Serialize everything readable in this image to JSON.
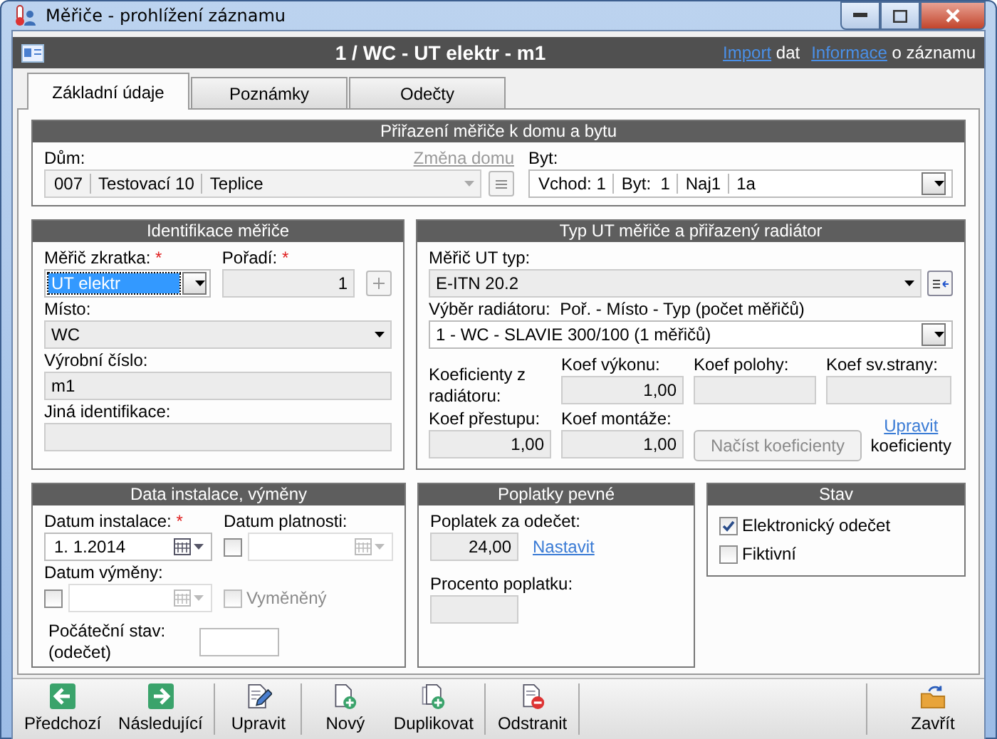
{
  "window": {
    "title": "Měřiče - prohlížení záznamu"
  },
  "header": {
    "title": "1 / WC - UT elektr - m1",
    "links": [
      {
        "link": "Import",
        "text": "dat"
      },
      {
        "link": "Informace",
        "text": "o záznamu"
      }
    ]
  },
  "tabs": [
    {
      "label": "Základní údaje",
      "selected": true
    },
    {
      "label": "Poznámky",
      "selected": false
    },
    {
      "label": "Odečty",
      "selected": false
    }
  ],
  "assignment": {
    "title": "Přiřazení měřiče k domu a bytu",
    "house_label": "Dům:",
    "change_link": "Změna domu",
    "house_cells": [
      "007",
      "Testovací 10",
      "Teplice"
    ],
    "flat_label": "Byt:",
    "flat_cells": [
      "Vchod: 1",
      "Byt:  1",
      "Naj1",
      "1a"
    ]
  },
  "identification": {
    "title": "Identifikace měřiče",
    "code": {
      "label": "Měřič zkratka:",
      "mark": "*",
      "value": "UT elektr"
    },
    "order": {
      "label": "Pořadí:",
      "mark": "*",
      "value": "1"
    },
    "place": {
      "label": "Místo:",
      "value": "WC"
    },
    "serial": {
      "label": "Výrobní číslo:",
      "value": "m1"
    },
    "other": {
      "label": "Jiná identifikace:"
    }
  },
  "meter_type": {
    "title": "Typ UT měřiče a přiřazený radiátor",
    "type": {
      "label": "Měřič UT typ:",
      "value": "E-ITN 20.2"
    },
    "radiator": {
      "label": "Výběr radiátoru:",
      "hint": "Poř. - Místo - Typ (počet měřičů)",
      "value": "1 - WC - SLAVIE 300/100 (1 měřičů)"
    },
    "coef_caption": "Koeficienty z radiátoru:",
    "coefs": [
      {
        "label": "Koef výkonu:",
        "value": "1,00"
      },
      {
        "label": "Koef polohy:"
      },
      {
        "label": "Koef sv.strany:"
      },
      {
        "label": "Koef přestupu:",
        "value": "1,00"
      },
      {
        "label": "Koef montáže:",
        "value": "1,00"
      }
    ],
    "load_button": "Načíst koeficienty",
    "edit_link": "Upravit",
    "edit_text": "koeficienty"
  },
  "installation": {
    "title": "Data instalace, výměny",
    "install": {
      "label": "Datum instalace:",
      "mark": "*",
      "value": "1.  1.2014"
    },
    "validity": {
      "label": "Datum platnosti:",
      "checked": false
    },
    "exchange": {
      "label": "Datum výměny:",
      "checked": false
    },
    "exchanged": {
      "label": "Vyměněný",
      "checked": false,
      "disabled": true
    },
    "initial": {
      "label": "Počáteční stav: (odečet)"
    }
  },
  "fees": {
    "title": "Poplatky pevné",
    "fee": {
      "label": "Poplatek za odečet:",
      "value": "24,00"
    },
    "set_link": "Nastavit",
    "percent": {
      "label": "Procento poplatku:"
    }
  },
  "status": {
    "title": "Stav",
    "options": [
      {
        "label": "Elektronický odečet",
        "checked": true
      },
      {
        "label": "Fiktivní",
        "checked": false
      }
    ]
  },
  "toolbar": [
    {
      "buttons": [
        {
          "label": "Předchozí",
          "kind": "previous"
        },
        {
          "label": "Následující",
          "kind": "next"
        }
      ]
    },
    {
      "buttons": [
        {
          "label": "Upravit",
          "kind": "edit"
        }
      ]
    },
    {
      "buttons": [
        {
          "label": "Nový",
          "kind": "new"
        },
        {
          "label": "Duplikovat",
          "kind": "duplicate"
        }
      ]
    },
    {
      "buttons": [
        {
          "label": "Odstranit",
          "kind": "delete"
        }
      ]
    },
    {
      "buttons": [
        {
          "label": "Zavřít",
          "kind": "close"
        }
      ]
    }
  ]
}
